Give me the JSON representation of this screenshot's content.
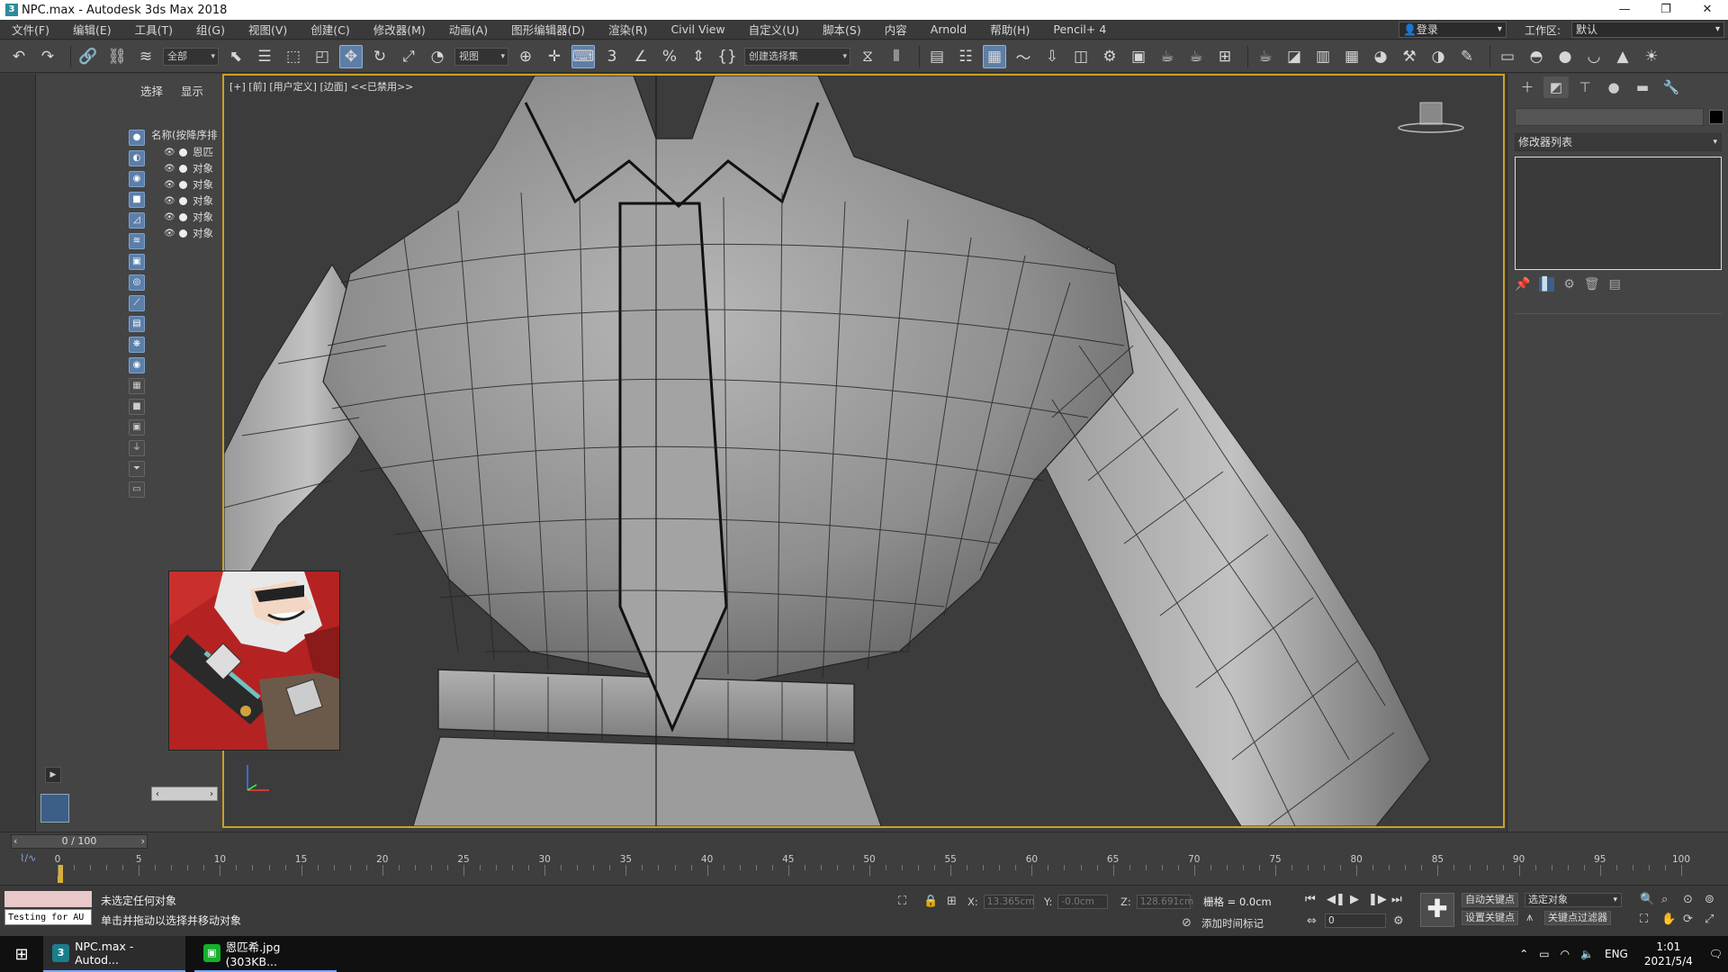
{
  "window": {
    "title": "NPC.max - Autodesk 3ds Max 2018",
    "app_icon": "3",
    "controls": [
      "—",
      "❐",
      "✕"
    ]
  },
  "menu": {
    "items": [
      "文件(F)",
      "编辑(E)",
      "工具(T)",
      "组(G)",
      "视图(V)",
      "创建(C)",
      "修改器(M)",
      "动画(A)",
      "图形编辑器(D)",
      "渲染(R)",
      "Civil View",
      "自定义(U)",
      "脚本(S)",
      "内容",
      "Arnold",
      "帮助(H)",
      "Pencil+ 4"
    ],
    "login": "登录",
    "workspace_label": "工作区:",
    "workspace_value": "默认"
  },
  "toolbar": {
    "selection_filter": "全部",
    "ref_coord": "视图",
    "named_selection": "创建选择集",
    "spinner_label": "3"
  },
  "scene_explorer": {
    "tabs": [
      "选择",
      "显示"
    ],
    "header": "名称(按降序排",
    "rows": [
      "恩匹",
      "对象",
      "对象",
      "对象",
      "对象",
      "对象"
    ]
  },
  "viewport": {
    "label": "[+] [前] [用户定义] [边面] <<已禁用>>"
  },
  "command_panel": {
    "modifier_list": "修改器列表"
  },
  "timeline": {
    "frame_display": "0 / 100",
    "ticks": [
      "0",
      "5",
      "10",
      "15",
      "20",
      "25",
      "30",
      "35",
      "40",
      "45",
      "50",
      "55",
      "60",
      "65",
      "70",
      "75",
      "80",
      "85",
      "90",
      "95",
      "100"
    ]
  },
  "status": {
    "maxscript_text": "Testing for AU",
    "line1": "未选定任何对象",
    "line2": "单击并拖动以选择并移动对象",
    "x_label": "X:",
    "x_value": "13.365cm",
    "y_label": "Y:",
    "y_value": "-0.0cm",
    "z_label": "Z:",
    "z_value": "128.691cm",
    "grid": "栅格 = 0.0cm",
    "add_time_tag": "添加时间标记",
    "auto_key": "自动关键点",
    "set_key": "设置关键点",
    "selected_object": "选定对象",
    "key_filters": "关键点过滤器",
    "frame_value": "0"
  },
  "taskbar": {
    "tasks": [
      {
        "label": "NPC.max - Autod...",
        "icon": "3",
        "color": "#1c7d8c"
      },
      {
        "label": "恩匹希.jpg (303KB...",
        "icon": "▣",
        "color": "#15b02a"
      }
    ],
    "lang": "ENG",
    "time": "1:01",
    "date": "2021/5/4"
  }
}
